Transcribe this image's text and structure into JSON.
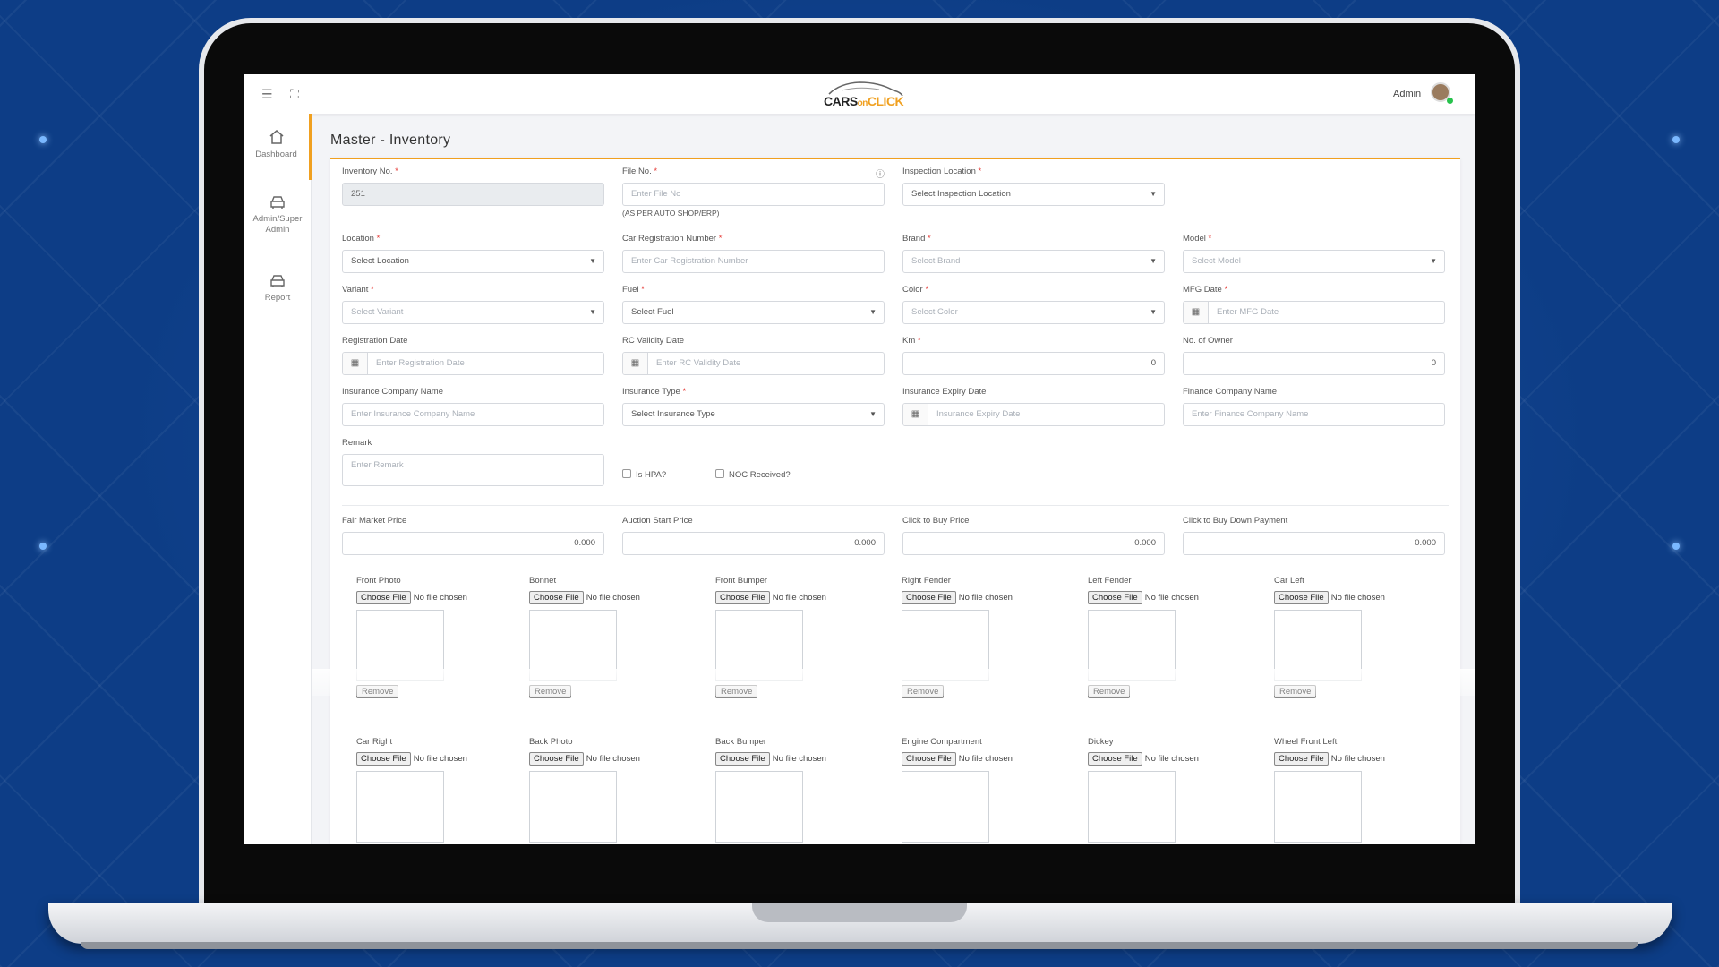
{
  "header": {
    "logo": {
      "part1": "CARS",
      "part2": "on",
      "part3": "CLICK"
    },
    "admin_name": "Admin"
  },
  "sidebar": {
    "items": [
      {
        "label": "Dashboard",
        "icon": "home-icon"
      },
      {
        "label": "Admin/Super Admin",
        "icon": "car-icon"
      },
      {
        "label": "Report",
        "icon": "car-icon"
      }
    ]
  },
  "page": {
    "title": "Master - Inventory"
  },
  "form": {
    "inventory_no": {
      "label": "Inventory No.",
      "value": "251"
    },
    "file_no": {
      "label": "File No.",
      "placeholder": "Enter File No",
      "note": "(AS PER AUTO SHOP/ERP)"
    },
    "inspection_location": {
      "label": "Inspection Location",
      "value": "Select Inspection Location"
    },
    "location": {
      "label": "Location",
      "value": "Select Location"
    },
    "car_registration_number": {
      "label": "Car Registration Number",
      "placeholder": "Enter Car Registration Number"
    },
    "brand": {
      "label": "Brand",
      "value": "Select Brand"
    },
    "model": {
      "label": "Model",
      "value": "Select Model"
    },
    "variant": {
      "label": "Variant",
      "value": "Select Variant"
    },
    "fuel": {
      "label": "Fuel",
      "value": "Select Fuel"
    },
    "color": {
      "label": "Color",
      "value": "Select Color"
    },
    "mfg_date": {
      "label": "MFG Date",
      "placeholder": "Enter MFG Date"
    },
    "registration_date": {
      "label": "Registration Date",
      "placeholder": "Enter Registration Date"
    },
    "rc_validity_date": {
      "label": "RC Validity Date",
      "placeholder": "Enter RC Validity Date"
    },
    "km": {
      "label": "Km",
      "value": "0"
    },
    "no_of_owner": {
      "label": "No. of Owner",
      "value": "0"
    },
    "insurance_company_name": {
      "label": "Insurance Company Name",
      "placeholder": "Enter Insurance Company Name"
    },
    "insurance_type": {
      "label": "Insurance Type",
      "value": "Select Insurance Type"
    },
    "insurance_expiry_date": {
      "label": "Insurance Expiry Date",
      "placeholder": "Insurance Expiry Date"
    },
    "finance_company_name": {
      "label": "Finance Company Name",
      "placeholder": "Enter Finance Company Name"
    },
    "remark": {
      "label": "Remark",
      "placeholder": "Enter Remark"
    },
    "is_hpa": {
      "label": "Is HPA?"
    },
    "noc_received": {
      "label": "NOC Received?"
    },
    "fair_market_price": {
      "label": "Fair Market Price",
      "value": "0.000"
    },
    "auction_start_price": {
      "label": "Auction Start Price",
      "value": "0.000"
    },
    "click_to_buy_price": {
      "label": "Click to Buy Price",
      "value": "0.000"
    },
    "click_to_buy_down_payment": {
      "label": "Click to Buy Down Payment",
      "value": "0.000"
    }
  },
  "photos": {
    "choose_label": "Choose File",
    "no_file_label": "No file chosen",
    "remove_label": "Remove",
    "row1": [
      "Front Photo",
      "Bonnet",
      "Front Bumper",
      "Right Fender",
      "Left Fender",
      "Car Left"
    ],
    "row2": [
      "Car Right",
      "Back Photo",
      "Back Bumper",
      "Engine Compartment",
      "Dickey",
      "Wheel Front Left"
    ]
  }
}
